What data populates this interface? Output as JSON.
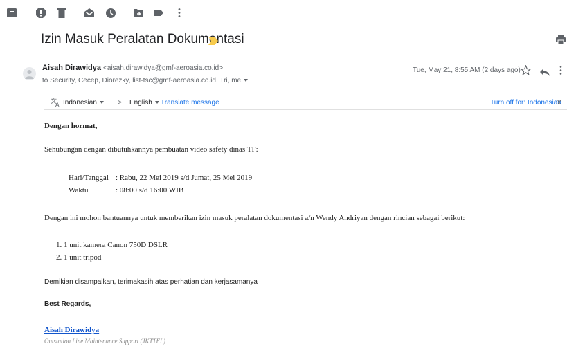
{
  "toolbar": {
    "icons": [
      "archive-icon",
      "report-spam-icon",
      "delete-icon",
      "mark-unread-icon",
      "snooze-icon",
      "move-to-icon",
      "labels-icon",
      "more-icon"
    ]
  },
  "email": {
    "subject": "Izin Masuk Peralatan Dokumentasi",
    "sender_name": "Aisah Dirawidya",
    "sender_email": "<aisah.dirawidya@gmf-aeroasia.co.id>",
    "recipients": "to Security, Cecep, Diorezky, list-tsc@gmf-aeroasia.co.id, Tri, me",
    "date": "Tue, May 21, 8:55 AM (2 days ago)"
  },
  "translate_bar": {
    "source_lang": "Indonesian",
    "arrow": ">",
    "target_lang": "English",
    "translate_link": "Translate message",
    "turn_off": "Turn off for: Indonesian",
    "close": "x"
  },
  "body": {
    "greeting": "Dengan hormat,",
    "intro": "Sehubungan dengan dibutuhkannya pembuatan video safety dinas TF:",
    "schedule": [
      {
        "label": "Hari/Tanggal",
        "value": ": Rabu, 22 Mei 2019 s/d Jumat, 25 Mei 2019"
      },
      {
        "label": "Waktu",
        "value": ": 08:00 s/d 16:00 WIB"
      }
    ],
    "request": "Dengan ini mohon bantuannya untuk memberikan izin masuk peralatan dokumentasi a/n Wendy Andriyan dengan rincian sebagai berikut:",
    "items": [
      "1.  1 unit kamera Canon 750D DSLR",
      "2.  1 unit tripod"
    ],
    "closing": "Demikian disampaikan, terimakasih atas perhatian dan kerjasamanya",
    "regards": "Best Regards,",
    "signature_name": "Aisah Dirawidya",
    "signature_dept": "Outstation Line Maintenance Support (JKTTFL)"
  },
  "colors": {
    "link": "#1a73e8",
    "signature_link": "#1155cc",
    "important_label": "#f7cb4d",
    "icon_grey": "#5f6368"
  }
}
